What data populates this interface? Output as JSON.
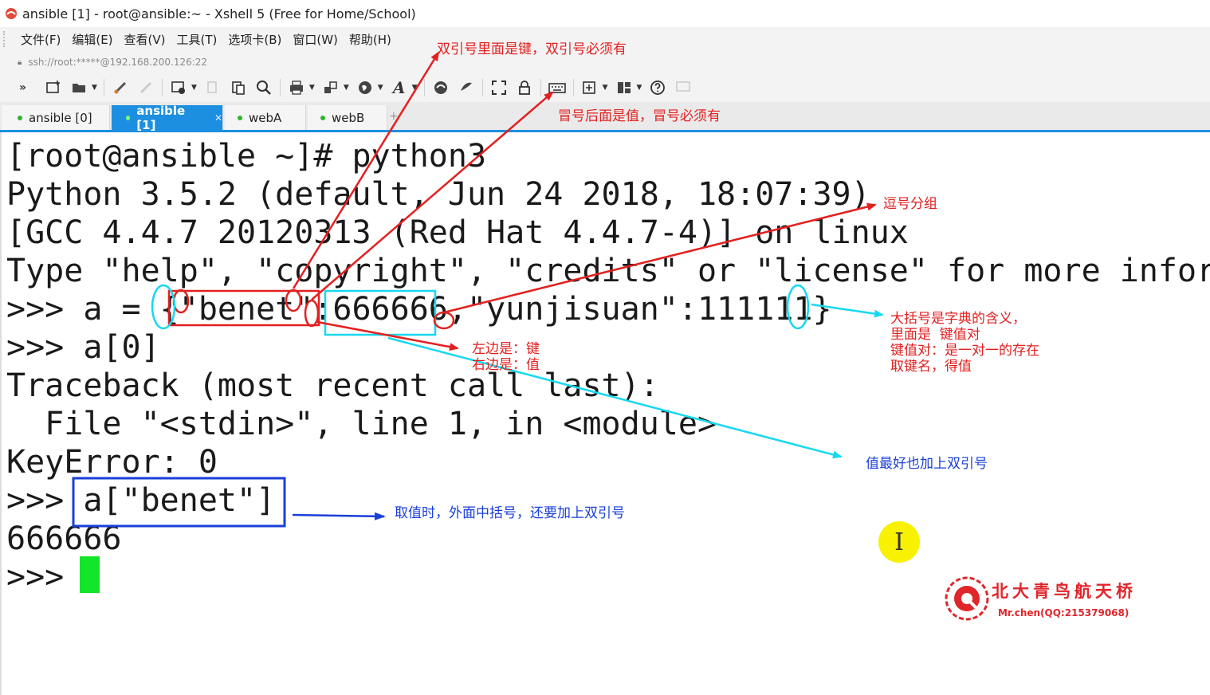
{
  "window": {
    "title": "ansible [1] - root@ansible:~ - Xshell 5 (Free for Home/School)"
  },
  "menu": [
    "文件(F)",
    "编辑(E)",
    "查看(V)",
    "工具(T)",
    "选项卡(B)",
    "窗口(W)",
    "帮助(H)"
  ],
  "address": "ssh://root:*****@192.168.200.126:22",
  "tabs": [
    {
      "label": "ansible [0]",
      "active": false
    },
    {
      "label": "ansible [1]",
      "active": true
    },
    {
      "label": "webA",
      "active": false
    },
    {
      "label": "webB",
      "active": false
    }
  ],
  "terminal": {
    "lines": [
      "[root@ansible ~]# python3",
      "Python 3.5.2 (default, Jun 24 2018, 18:07:39)",
      "[GCC 4.4.7 20120313 (Red Hat 4.4.7-4)] on linux",
      "Type \"help\", \"copyright\", \"credits\" or \"license\" for more informa",
      ">>> a = {\"benet\":666666,\"yunjisuan\":111111}",
      ">>> a[0]",
      "Traceback (most recent call last):",
      "  File \"<stdin>\", line 1, in <module>",
      "KeyError: 0",
      ">>> a[\"benet\"]",
      "666666",
      ">>> "
    ]
  },
  "annotations": {
    "a1": "双引号里面是键，双引号必须有",
    "a2": "冒号后面是值，冒号必须有",
    "a3": "逗号分组",
    "a4": "大括号是字典的含义，\n里面是  键值对\n键值对：是一对一的存在\n取键名，得值",
    "a5": "左边是：键\n右边是：值",
    "a6": "值最好也加上双引号",
    "a7": "取值时，外面中括号，还要加上双引号"
  },
  "watermark": {
    "name": "北大青鸟航天桥",
    "sub": "Mr.chen(QQ:215379068)"
  },
  "colors": {
    "accent": "#1c8fe0",
    "annotation_red": "#e32020",
    "annotation_cyan": "#18d8f0",
    "annotation_blue": "#1a3fd9",
    "cursor": "#13e52a"
  }
}
